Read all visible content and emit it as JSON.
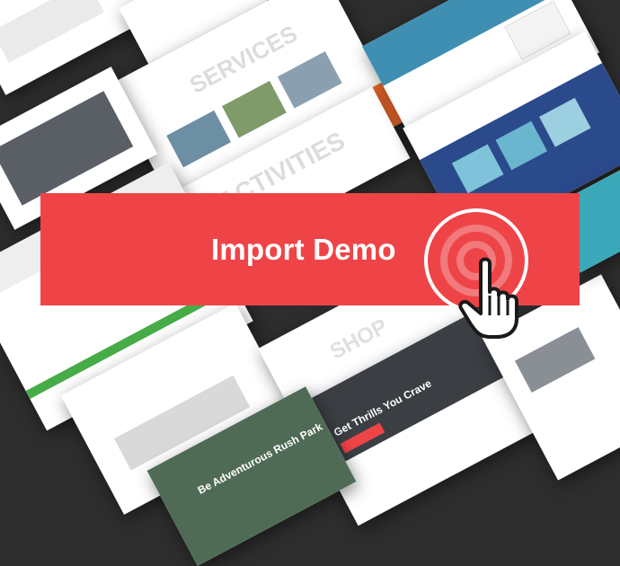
{
  "banner": {
    "title": "Import Demo"
  },
  "tiles": {
    "services_heading": "SERVICES",
    "activities_heading": "ACTIVITIES",
    "shop_heading": "SHOP",
    "adventure_heading": "Be Adventurous Rush Park",
    "cta_heading": "Get Thrills You Crave"
  },
  "colors": {
    "background": "#2d2d2d",
    "banner": "#ef4447",
    "accent_orange": "#f26b2c",
    "accent_green": "#47ab48",
    "accent_blue": "#2b4a8c"
  },
  "icons": {
    "cursor": "hand-pointer-icon",
    "target": "target-rings-icon"
  }
}
